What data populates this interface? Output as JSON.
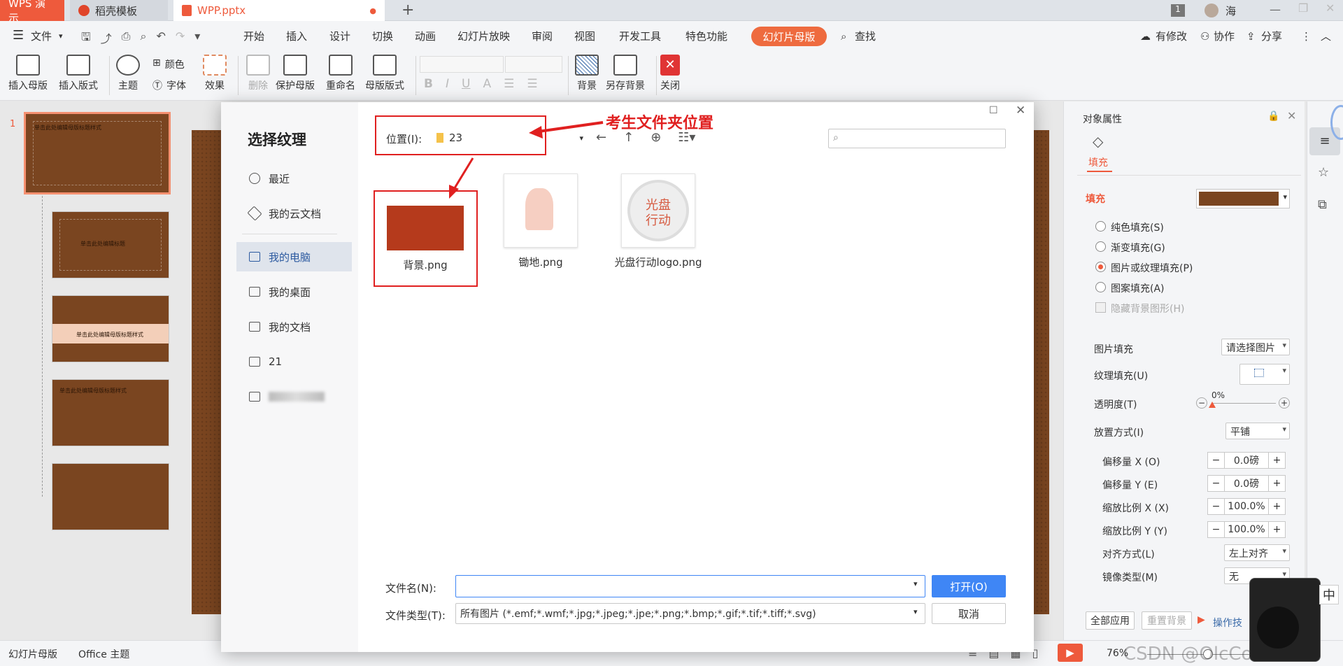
{
  "tabs": {
    "wps": "WPS 演示",
    "daoke": "稻壳模板",
    "doc": "WPP.pptx",
    "add": "+",
    "badge": "1",
    "user": "海"
  },
  "menu": {
    "file": "文件",
    "items": [
      "开始",
      "插入",
      "设计",
      "切换",
      "动画",
      "幻灯片放映",
      "审阅",
      "视图",
      "开发工具",
      "特色功能"
    ],
    "master": "幻灯片母版",
    "find": "查找",
    "modify": "有修改",
    "collab": "协作",
    "share": "分享"
  },
  "ribbon": {
    "insert_master": "插入母版",
    "insert_layout": "插入版式",
    "theme": "主题",
    "color": "颜色",
    "font": "字体",
    "effect": "效果",
    "delete": "删除",
    "protect": "保护母版",
    "rename": "重命名",
    "layout": "母版版式",
    "background": "背景",
    "save_bg": "另存背景",
    "close": "关闭"
  },
  "thumbs": {
    "num": "1",
    "t1": "单击此处编辑母版标题样式",
    "t2": "单击此处编辑标题",
    "t3": "单击此处编辑母版标题样式",
    "t4": "单击此处编辑母版标题样式"
  },
  "dialog": {
    "title": "选择纹理",
    "nav": [
      "最近",
      "我的云文档",
      "我的电脑",
      "我的桌面",
      "我的文档",
      "21"
    ],
    "location_label": "位置(I):",
    "location_value": "23",
    "annotation": "考生文件夹位置",
    "files": [
      {
        "name": "背景.png"
      },
      {
        "name": "锄地.png"
      },
      {
        "name": "光盘行动logo.png"
      }
    ],
    "logo_text": "光盘\n行动",
    "filename_label": "文件名(N):",
    "filename_value": "",
    "filetype_label": "文件类型(T):",
    "filetype_value": "所有图片 (*.emf;*.wmf;*.jpg;*.jpeg;*.jpe;*.png;*.bmp;*.gif;*.tif;*.tiff;*.svg)",
    "open": "打开(O)",
    "cancel": "取消"
  },
  "rpane": {
    "title": "对象属性",
    "tab": "填充",
    "section": "填充",
    "options": [
      "纯色填充(S)",
      "渐变填充(G)",
      "图片或纹理填充(P)",
      "图案填充(A)"
    ],
    "hide_bg": "隐藏背景图形(H)",
    "pic_fill_label": "图片填充",
    "pic_fill_value": "请选择图片",
    "tex_fill_label": "纹理填充(U)",
    "trans_label": "透明度(T)",
    "trans_value": "0%",
    "place_label": "放置方式(I)",
    "place_value": "平铺",
    "offx_label": "偏移量 X (O)",
    "offx": "0.0磅",
    "offy_label": "偏移量 Y (E)",
    "offy": "0.0磅",
    "scalex_label": "缩放比例 X (X)",
    "scalex": "100.0%",
    "scaley_label": "缩放比例 Y (Y)",
    "scaley": "100.0%",
    "align_label": "对齐方式(L)",
    "align_value": "左上对齐",
    "mirror_label": "镜像类型(M)",
    "mirror_value": "无",
    "apply_all": "全部应用",
    "reset_bg": "重置背景",
    "tips": "操作技"
  },
  "status": {
    "mode": "幻灯片母版",
    "theme": "Office 主题",
    "zoom": "76%",
    "watermark": "CSDN @OlcCorectt"
  },
  "ime": "中"
}
